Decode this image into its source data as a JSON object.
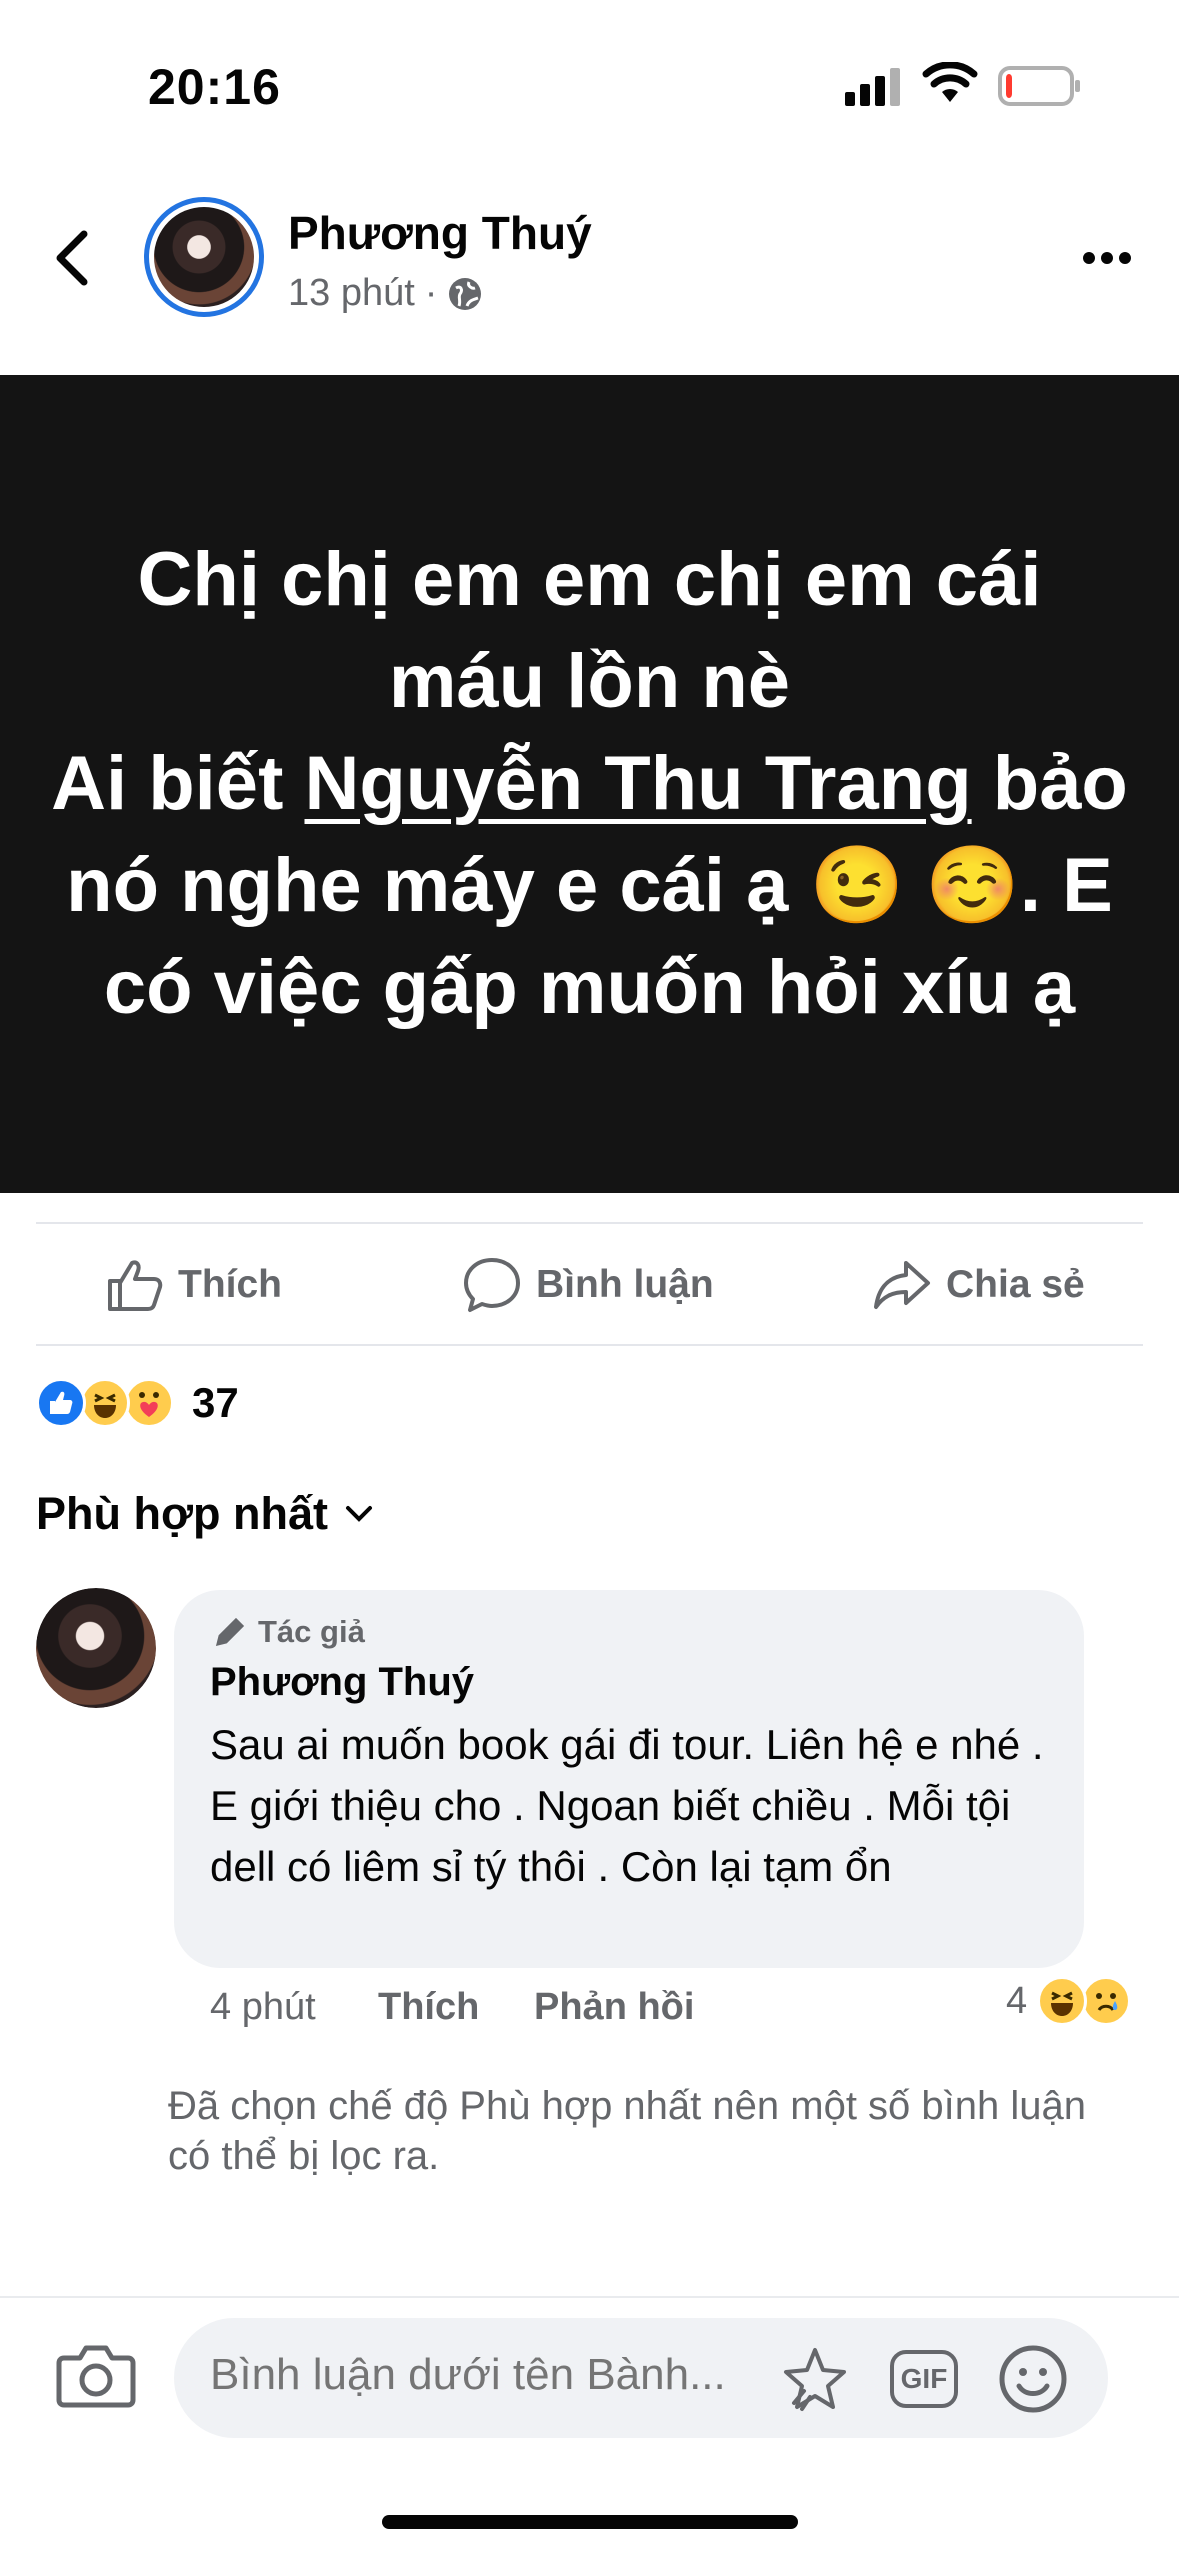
{
  "status_bar": {
    "time": "20:16",
    "battery_level": 0.1,
    "signal_icon": "signal-bars-icon",
    "wifi_icon": "wifi-icon",
    "battery_icon": "battery-low-icon"
  },
  "header": {
    "author": "Phương Thuý",
    "time": "13 phút",
    "separator": "·",
    "privacy_icon": "globe-icon",
    "back_icon": "chevron-left-icon",
    "more_icon": "more-dots-icon"
  },
  "post": {
    "background": "#141414",
    "text_color": "#ffffff",
    "line1": "Chị chị em em chị em cái",
    "line2": "máu lồn nè",
    "line3_pre": "Ai biết ",
    "mention": "Nguyễn Thu Trang",
    "line3_post": " bảo nó nghe máy e cái ạ ",
    "emoji1": "😉",
    "emoji2": "☺️",
    "line4": ". E có việc gấp muốn hỏi xíu ạ"
  },
  "actions": {
    "like": "Thích",
    "comment": "Bình luận",
    "share": "Chia sẻ"
  },
  "reactions": {
    "count": "37",
    "types": [
      "like",
      "haha",
      "care"
    ],
    "like_color": "#1877f2"
  },
  "sort": {
    "label": "Phù hợp nhất"
  },
  "comment": {
    "badge": "Tác giả",
    "author": "Phương Thuý",
    "text": "Sau ai muốn book gái đi tour. Liên hệ e nhé . E giới thiệu cho . Ngoan biết chiều . Mỗi tội dell có liêm sỉ tý thôi . Còn lại tạm ổn",
    "time": "4 phút",
    "like": "Thích",
    "reply": "Phản hồi",
    "reaction_count": "4",
    "reaction_types": [
      "haha",
      "sad"
    ]
  },
  "filter_note": "Đã chọn chế độ Phù hợp nhất nên một số bình luận có thể bị lọc ra.",
  "composer": {
    "placeholder": "Bình luận dưới tên Bành...",
    "gif_label": "GIF"
  },
  "colors": {
    "accent": "#2374e1",
    "secondary_text": "#65676b",
    "bubble": "#f0f2f5"
  }
}
